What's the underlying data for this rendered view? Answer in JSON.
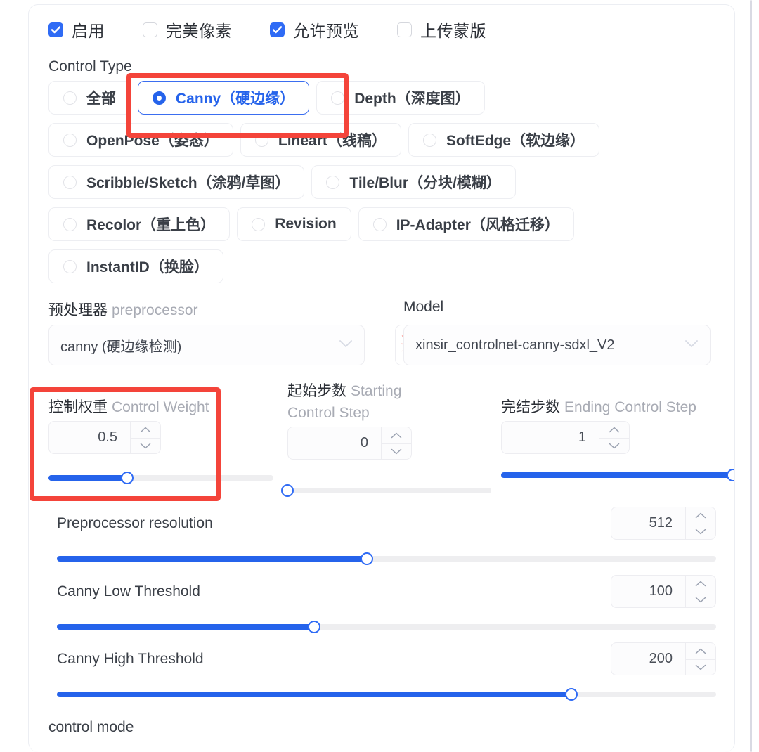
{
  "checkboxes": [
    {
      "label": "启用",
      "checked": true,
      "name": "enable"
    },
    {
      "label": "完美像素",
      "checked": false,
      "name": "pixel-perfect"
    },
    {
      "label": "允许预览",
      "checked": true,
      "name": "allow-preview"
    },
    {
      "label": "上传蒙版",
      "checked": false,
      "name": "upload-mask"
    }
  ],
  "control_type": {
    "label": "Control Type",
    "rows": [
      [
        {
          "label": "全部",
          "selected": false
        },
        {
          "label": "Canny（硬边缘）",
          "selected": true
        },
        {
          "label": "Depth（深度图）",
          "selected": false
        }
      ],
      [
        {
          "label": "OpenPose（姿态）",
          "selected": false
        },
        {
          "label": "Lineart（线稿）",
          "selected": false
        },
        {
          "label": "SoftEdge（软边缘）",
          "selected": false
        }
      ],
      [
        {
          "label": "Scribble/Sketch（涂鸦/草图）",
          "selected": false
        },
        {
          "label": "Tile/Blur（分块/模糊）",
          "selected": false
        }
      ],
      [
        {
          "label": "Recolor（重上色）",
          "selected": false
        },
        {
          "label": "Revision",
          "selected": false
        },
        {
          "label": "IP-Adapter（风格迁移）",
          "selected": false
        }
      ],
      [
        {
          "label": "InstantID（换脸）",
          "selected": false
        }
      ]
    ]
  },
  "preprocessor": {
    "label_zh": "预处理器",
    "label_en": "preprocessor",
    "value": "canny (硬边缘检测)",
    "chevron": "chevron-down-icon"
  },
  "spark_button": {
    "icon": "explosion-icon",
    "glyph": "💥"
  },
  "model": {
    "label": "Model",
    "value": "xinsir_controlnet-canny-sdxl_V2",
    "chevron": "chevron-down-icon"
  },
  "control_weight": {
    "label_zh": "控制权重",
    "label_en": "Control Weight",
    "value": "0.5",
    "slider_percent": 35
  },
  "starting_step": {
    "label_zh": "起始步数",
    "label_en": "Starting Control Step",
    "value": "0",
    "slider_percent": 0
  },
  "ending_step": {
    "label_zh": "完结步数",
    "label_en": "Ending Control Step",
    "value": "1",
    "slider_percent": 100
  },
  "sliders": [
    {
      "label": "Preprocessor resolution",
      "value": "512",
      "slider_percent": 47
    },
    {
      "label": "Canny Low Threshold",
      "value": "100",
      "slider_percent": 39
    },
    {
      "label": "Canny High Threshold",
      "value": "200",
      "slider_percent": 78
    }
  ],
  "control_mode": {
    "label": "control mode"
  },
  "colors": {
    "accent_blue": "#2563eb",
    "checkbox_blue": "#2f6bf5",
    "annotation_red": "#f4443a",
    "track_gray": "#eeeef0",
    "text_dark": "#3a3f47",
    "text_muted": "#a8abb4"
  },
  "annotations": [
    {
      "name": "canny-highlight",
      "target": "Canny（硬边缘）"
    },
    {
      "name": "weight-highlight",
      "target": "控制权重 Control Weight"
    }
  ]
}
